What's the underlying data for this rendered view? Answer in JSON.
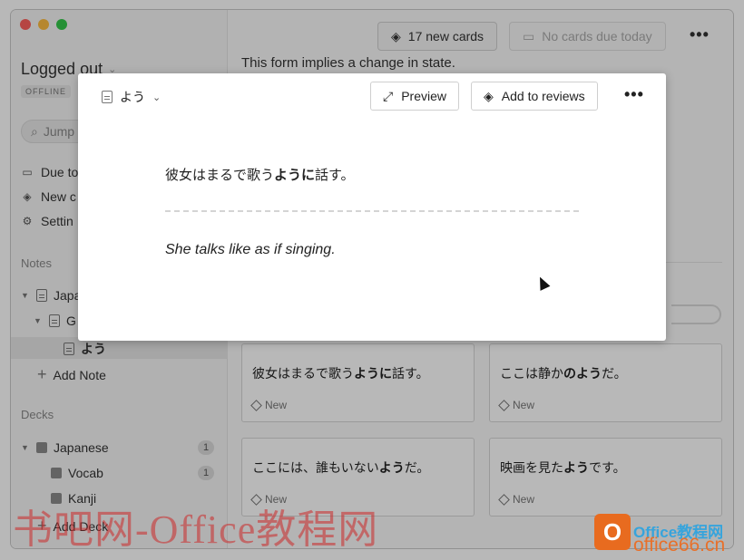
{
  "sidebar": {
    "user_name": "Logged out",
    "status_badge": "OFFLINE",
    "search_placeholder": "Jump",
    "links": [
      {
        "label": "Due to",
        "icon": "inbox-icon"
      },
      {
        "label": "New c",
        "icon": "stack-icon"
      },
      {
        "label": "Settin",
        "icon": "gear-icon"
      }
    ],
    "notes_heading": "Notes",
    "notes_tree": [
      {
        "label": "Japa"
      },
      {
        "label": "G"
      },
      {
        "label": "よう"
      }
    ],
    "add_note_label": "Add Note",
    "decks_heading": "Decks",
    "decks": [
      {
        "label": "Japanese",
        "count": "1"
      },
      {
        "label": "Vocab",
        "count": "1"
      },
      {
        "label": "Kanji",
        "count": ""
      }
    ],
    "add_deck_label": "Add Deck"
  },
  "toolbar": {
    "new_cards_label": "17 new cards",
    "no_cards_label": "No cards due today"
  },
  "main": {
    "bg_text": "This form implies a change in state.",
    "cards": [
      {
        "pre": "彼女はまるで歌う",
        "bold": "ように",
        "post": "話す。",
        "tag": "New"
      },
      {
        "pre": "ここは静か",
        "bold": "のよう",
        "post": "だ。",
        "tag": "New"
      },
      {
        "pre": "ここには、誰もいない",
        "bold": "よう",
        "post": "だ。",
        "tag": "New"
      },
      {
        "pre": "映画を見た",
        "bold": "よう",
        "post": "です。",
        "tag": "New"
      }
    ]
  },
  "modal": {
    "title": "よう",
    "preview_label": "Preview",
    "add_reviews_label": "Add to reviews",
    "front_pre": "彼女はまるで歌う",
    "front_bold": "ように",
    "front_post": "話す。",
    "back": "She talks like as if singing."
  },
  "watermark": {
    "text": "书吧网-Office教程网",
    "logo_top": "Office教程网",
    "logo_bottom": "office66.cn"
  }
}
